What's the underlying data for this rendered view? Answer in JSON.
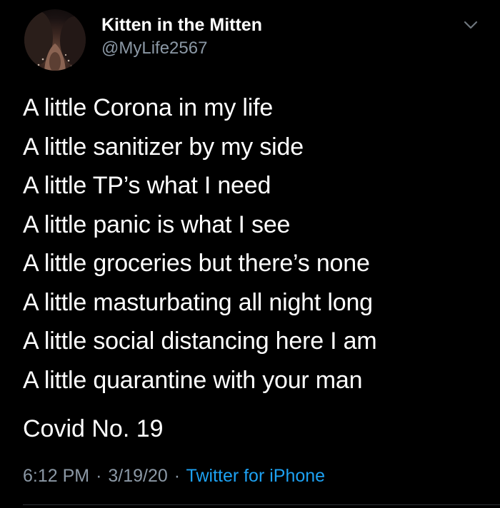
{
  "author": {
    "display_name": "Kitten in the Mitten",
    "handle": "@MyLife2567",
    "avatar_icon": "profile-photo"
  },
  "menu_icon": "chevron-down-icon",
  "poem_lines": [
    "A little Corona in my life",
    "A little sanitizer by my side",
    "A little TP’s what I need",
    "A little panic is what I see",
    "A little groceries but there’s none",
    "A little masturbating all night long",
    "A little social distancing here I am",
    "A little quarantine with your man"
  ],
  "signoff": "Covid No. 19",
  "meta": {
    "time": "6:12 PM",
    "separator": "·",
    "date": "3/19/20",
    "source": "Twitter for iPhone"
  },
  "colors": {
    "background": "#000000",
    "text": "#ffffff",
    "secondary_text": "#8b98a5",
    "link": "#1da1f2"
  }
}
